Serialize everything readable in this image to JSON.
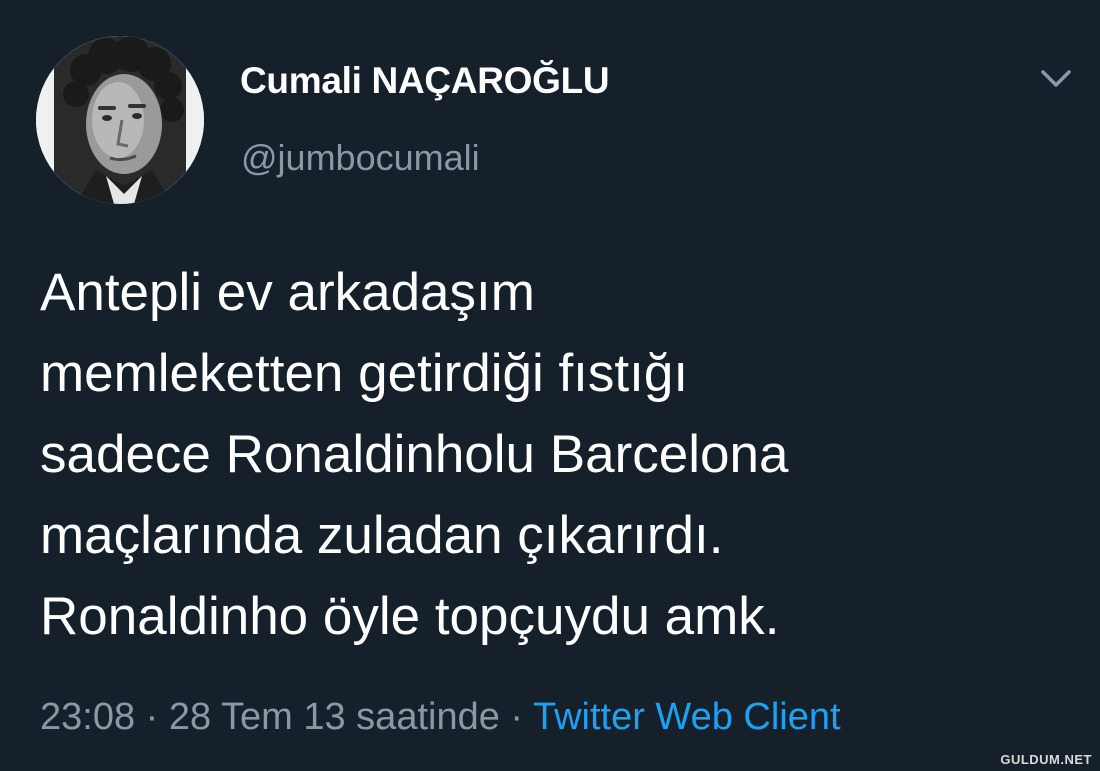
{
  "tweet": {
    "author": {
      "display_name": "Cumali NAÇAROĞLU",
      "handle": "@jumbocumali",
      "avatar_icon": "person-portrait-icon"
    },
    "menu_icon": "chevron-down-icon",
    "text_lines": [
      "Antepli ev arkadaşım",
      "memleketten getirdiği fıstığı",
      "sadece Ronaldinholu Barcelona",
      "maçlarında zuladan çıkarırdı.",
      "Ronaldinho öyle topçuydu amk."
    ],
    "time": "23:08",
    "separator": " · ",
    "date": "28 Tem 13 saatinde",
    "source": "Twitter Web Client"
  },
  "watermark": "GULDUM.NET",
  "colors": {
    "background": "#15202b",
    "text": "#ffffff",
    "muted": "#8899a6",
    "link": "#1da1f2"
  }
}
